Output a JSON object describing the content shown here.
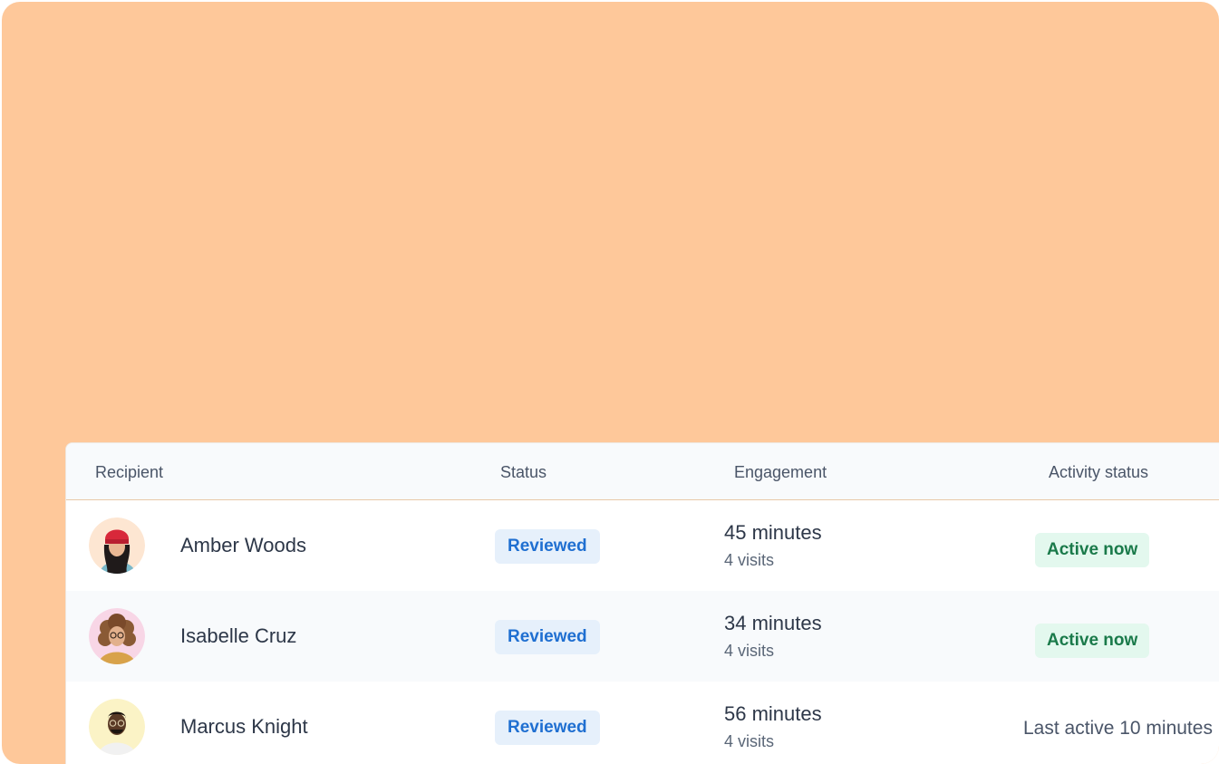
{
  "table": {
    "headers": {
      "recipient": "Recipient",
      "status": "Status",
      "engagement": "Engagement",
      "activity": "Activity status"
    },
    "rows": [
      {
        "name": "Amber Woods",
        "status": "Reviewed",
        "engagement": "45 minutes",
        "visits": "4 visits",
        "activity": "Active now",
        "avatar": "avatar-woman-red-beanie"
      },
      {
        "name": "Isabelle Cruz",
        "status": "Reviewed",
        "engagement": "34 minutes",
        "visits": "4 visits",
        "activity": "Active now",
        "avatar": "avatar-woman-curly-hair"
      },
      {
        "name": "Marcus Knight",
        "status": "Reviewed",
        "engagement": "56 minutes",
        "visits": "4 visits",
        "activity": "Last active 10 minutes",
        "avatar": "avatar-man-glasses"
      }
    ]
  },
  "colors": {
    "background": "#fec89a",
    "reviewed_badge_bg": "#e6f0fb",
    "reviewed_badge_text": "#1f6fd1",
    "active_badge_bg": "#e3f8ee",
    "active_badge_text": "#1a7a4a"
  }
}
